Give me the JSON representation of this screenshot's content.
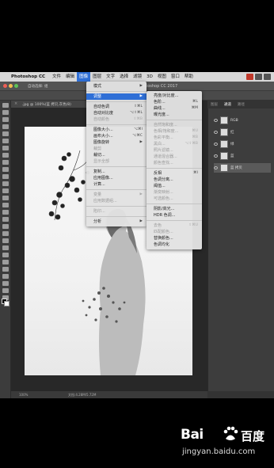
{
  "menubar": {
    "app_name": "Photoshop CC",
    "items": [
      "文件",
      "编辑",
      "图像",
      "图层",
      "文字",
      "选择",
      "滤镜",
      "3D",
      "视图",
      "窗口",
      "帮助"
    ],
    "active_index": 2
  },
  "window": {
    "title": "Photoshop CC 2017",
    "options_text": "自动选择: 组",
    "doc_tab": ".jpg @ 100%(蓝 拷贝,灰色/8)"
  },
  "status": {
    "zoom": "100%",
    "doc_info": "文档:4.28M/5.72M"
  },
  "panel": {
    "tabs": [
      "图层",
      "通道",
      "路径"
    ],
    "active_tab": 1,
    "layers": [
      "RGB",
      "红",
      "绿",
      "蓝",
      "蓝 拷贝"
    ],
    "selected_layer": 4
  },
  "image_menu": {
    "items": [
      {
        "label": "模式",
        "sub": true
      },
      {
        "sep": true
      },
      {
        "label": "调整",
        "sub": true,
        "highlight": true
      },
      {
        "sep": true
      },
      {
        "label": "自动色调",
        "shortcut": "⇧⌘L"
      },
      {
        "label": "自动对比度",
        "shortcut": "⌥⇧⌘L"
      },
      {
        "label": "自动颜色",
        "shortcut": "⇧⌘B",
        "disabled": true
      },
      {
        "sep": true
      },
      {
        "label": "图像大小...",
        "shortcut": "⌥⌘I"
      },
      {
        "label": "画布大小...",
        "shortcut": "⌥⌘C"
      },
      {
        "label": "图像旋转",
        "sub": true
      },
      {
        "label": "裁剪",
        "disabled": true
      },
      {
        "label": "裁切..."
      },
      {
        "label": "显示全部",
        "disabled": true
      },
      {
        "sep": true
      },
      {
        "label": "复制..."
      },
      {
        "label": "应用图像..."
      },
      {
        "label": "计算..."
      },
      {
        "sep": true
      },
      {
        "label": "变量",
        "sub": true,
        "disabled": true
      },
      {
        "label": "应用数据组...",
        "disabled": true
      },
      {
        "sep": true
      },
      {
        "label": "陷印...",
        "disabled": true
      },
      {
        "sep": true
      },
      {
        "label": "分析",
        "sub": true
      }
    ]
  },
  "adjust_menu": {
    "items": [
      {
        "label": "亮度/对比度..."
      },
      {
        "label": "色阶...",
        "shortcut": "⌘L"
      },
      {
        "label": "曲线...",
        "shortcut": "⌘M"
      },
      {
        "label": "曝光度..."
      },
      {
        "sep": true
      },
      {
        "label": "自然饱和度...",
        "disabled": true
      },
      {
        "label": "色相/饱和度...",
        "shortcut": "⌘U",
        "disabled": true
      },
      {
        "label": "色彩平衡...",
        "shortcut": "⌘B",
        "disabled": true
      },
      {
        "label": "黑白...",
        "shortcut": "⌥⇧⌘B",
        "disabled": true
      },
      {
        "label": "照片滤镜...",
        "disabled": true
      },
      {
        "label": "通道混合器...",
        "disabled": true
      },
      {
        "label": "颜色查找...",
        "disabled": true
      },
      {
        "sep": true
      },
      {
        "label": "反相",
        "shortcut": "⌘I"
      },
      {
        "label": "色调分离..."
      },
      {
        "label": "阈值..."
      },
      {
        "label": "渐变映射...",
        "disabled": true
      },
      {
        "label": "可选颜色...",
        "disabled": true
      },
      {
        "sep": true
      },
      {
        "label": "阴影/高光..."
      },
      {
        "label": "HDR 色调..."
      },
      {
        "sep": true
      },
      {
        "label": "去色",
        "shortcut": "⇧⌘U",
        "disabled": true
      },
      {
        "label": "匹配颜色...",
        "disabled": true
      },
      {
        "label": "替换颜色..."
      },
      {
        "label": "色调均化"
      }
    ]
  },
  "watermark": {
    "brand": "Bai",
    "brand_cn": "百度",
    "url": "jingyan.baidu.com"
  },
  "colors": {
    "accent": "#2f6fd6",
    "menubar": "#d8d8d8",
    "panel": "#3d3d3d"
  }
}
